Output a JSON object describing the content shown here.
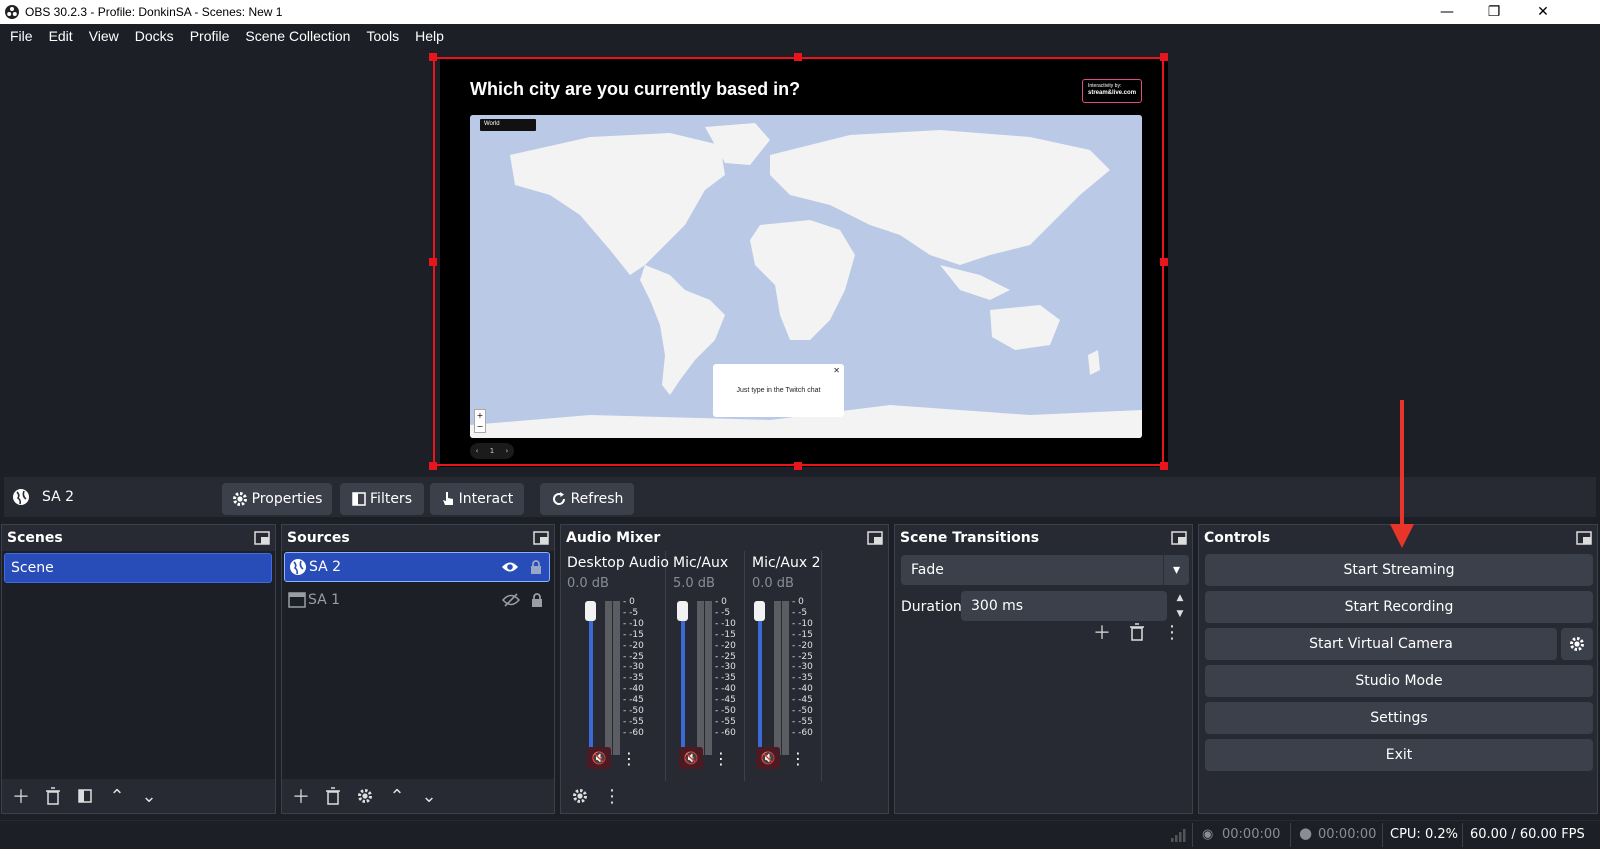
{
  "window": {
    "title": "OBS 30.2.3 - Profile: DonkinSA - Scenes: New 1"
  },
  "menu": [
    "File",
    "Edit",
    "View",
    "Docks",
    "Profile",
    "Scene Collection",
    "Tools",
    "Help"
  ],
  "preview": {
    "question": "Which city are you currently based in?",
    "badge_top": "Interactivity by:",
    "badge_brand": "stream&live.com",
    "map_select": "World",
    "popup_text": "Just type in the Twitch chat",
    "pager_page": "1"
  },
  "source_toolbar": {
    "selected_source": "SA 2",
    "properties": "Properties",
    "filters": "Filters",
    "interact": "Interact",
    "refresh": "Refresh"
  },
  "scenes": {
    "title": "Scenes",
    "items": [
      "Scene"
    ]
  },
  "sources": {
    "title": "Sources",
    "items": [
      {
        "name": "SA 2",
        "visible": true,
        "locked": true
      },
      {
        "name": "SA 1",
        "visible": false,
        "locked": true
      }
    ]
  },
  "audio_mixer": {
    "title": "Audio Mixer",
    "channels": [
      {
        "name": "Desktop Audio",
        "db": "0.0 dB",
        "muted": true
      },
      {
        "name": "Mic/Aux",
        "db": "5.0 dB",
        "muted": true
      },
      {
        "name": "Mic/Aux 2",
        "db": "0.0 dB",
        "muted": true
      }
    ],
    "scale": [
      "0",
      "-5",
      "-10",
      "-15",
      "-20",
      "-25",
      "-30",
      "-35",
      "-40",
      "-45",
      "-50",
      "-55",
      "-60"
    ]
  },
  "transitions": {
    "title": "Scene Transitions",
    "selected": "Fade",
    "duration_label": "Duration",
    "duration_value": "300 ms"
  },
  "controls": {
    "title": "Controls",
    "start_streaming": "Start Streaming",
    "start_recording": "Start Recording",
    "start_virtual_camera": "Start Virtual Camera",
    "studio_mode": "Studio Mode",
    "settings": "Settings",
    "exit": "Exit"
  },
  "status": {
    "stream_time": "00:00:00",
    "record_time": "00:00:00",
    "cpu": "CPU: 0.2%",
    "fps": "60.00 / 60.00 FPS"
  },
  "colors": {
    "accent": "#284cb8",
    "selection_red": "#e8161c",
    "panel": "#272a33",
    "bg": "#1d1f26",
    "button": "#3c404b"
  }
}
